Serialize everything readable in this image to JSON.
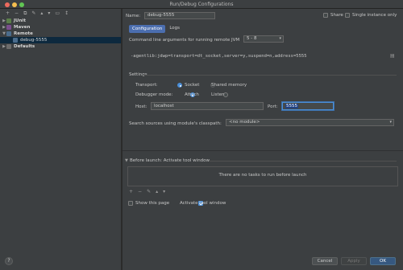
{
  "window": {
    "title": "Run/Debug Configurations"
  },
  "colors": {
    "accent": "#4b6eaf",
    "selection": "#0d293e",
    "primary_button": "#365880",
    "port_highlight": "#214283"
  },
  "left_toolbar": {
    "items": [
      "+",
      "−",
      "⧉",
      "✎",
      "▴",
      "▾",
      "▭",
      "↕"
    ]
  },
  "tree": {
    "junit": "JUnit",
    "maven": "Maven",
    "remote": "Remote",
    "debug_5555": "debug-5555",
    "defaults": "Defaults"
  },
  "header": {
    "name_label": "Name:",
    "name_value": "debug-5555",
    "share_label": "Share",
    "share_checked": false,
    "single_instance_label": "Single instance only",
    "single_instance_checked": false
  },
  "tabs": {
    "configuration": "Configuration",
    "logs": "Logs"
  },
  "jvm": {
    "label": "Command line arguments for running remote JVM",
    "version_value": "5 - 8",
    "args": "-agentlib:jdwp=transport=dt_socket,server=y,suspend=n,address=5555"
  },
  "settings": {
    "title": "Settings",
    "transport_label": "Transport:",
    "socket": "Socket",
    "shared_memory": "Shared memory",
    "debugger_mode_label": "Debugger mode:",
    "attach": "Attach",
    "listen": "Listen",
    "host_label": "Host:",
    "host_value": "localhost",
    "port_label": "Port:",
    "port_value": "5555"
  },
  "classpath": {
    "label": "Search sources using module's classpath:",
    "value": "<no module>"
  },
  "before_launch": {
    "title": "Before launch: Activate tool window",
    "empty_text": "There are no tasks to run before launch",
    "toolbar": [
      "+",
      "−",
      "✎",
      "▴",
      "▾"
    ],
    "show_page_label": "Show this page",
    "show_page_checked": false,
    "activate_label": "Activate tool window",
    "activate_checked": true
  },
  "buttons": {
    "cancel": "Cancel",
    "apply": "Apply",
    "ok": "OK",
    "help": "?"
  }
}
